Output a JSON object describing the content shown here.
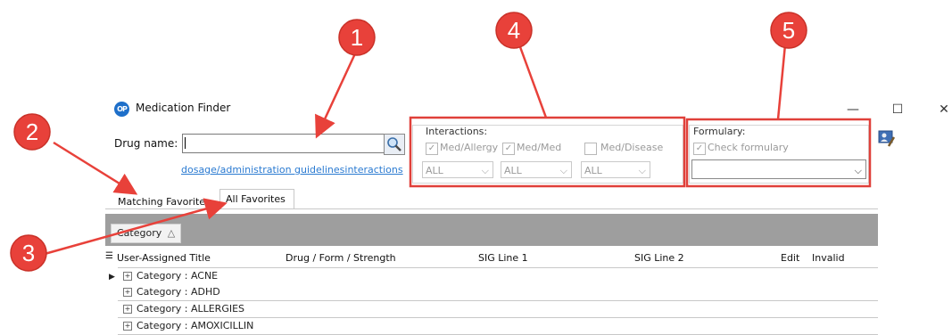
{
  "window": {
    "icon_text": "OP",
    "title": "Medication Finder",
    "controls": {
      "minimize": "—",
      "maximize": "☐",
      "close": "✕"
    }
  },
  "search": {
    "drug_name_label": "Drug name:",
    "drug_name_value": "",
    "links": [
      "dosage/administration guidelines",
      "interactions"
    ]
  },
  "interactions": {
    "title": "Interactions:",
    "checkboxes": [
      {
        "label": "Med/Allergy",
        "checked": true
      },
      {
        "label": "Med/Med",
        "checked": true
      },
      {
        "label": "Med/Disease",
        "checked": false
      }
    ],
    "selects": [
      "ALL",
      "ALL",
      "ALL"
    ]
  },
  "formulary": {
    "title": "Formulary:",
    "checkbox_label": "Check formulary",
    "checked": true,
    "select_value": ""
  },
  "tabs": [
    {
      "label": "Matching Favorites",
      "active": false
    },
    {
      "label": "All Favorites",
      "active": true
    }
  ],
  "grouping": {
    "chip_label": "Category",
    "sort_glyph": "△"
  },
  "grid": {
    "columns": [
      "User-Assigned Title",
      "Drug / Form / Strength",
      "SIG Line 1",
      "SIG Line 2",
      "Edit",
      "Invalid"
    ],
    "rows": [
      "Category : ACNE",
      "Category : ADHD",
      "Category : ALLERGIES",
      "Category : AMOXICILLIN"
    ]
  },
  "annotations": [
    "1",
    "2",
    "3",
    "4",
    "5"
  ],
  "colors": {
    "annotation": "#e8413a",
    "annotation_border": "#c93128",
    "link": "#2a7ad1",
    "group_panel": "#9e9e9e"
  }
}
